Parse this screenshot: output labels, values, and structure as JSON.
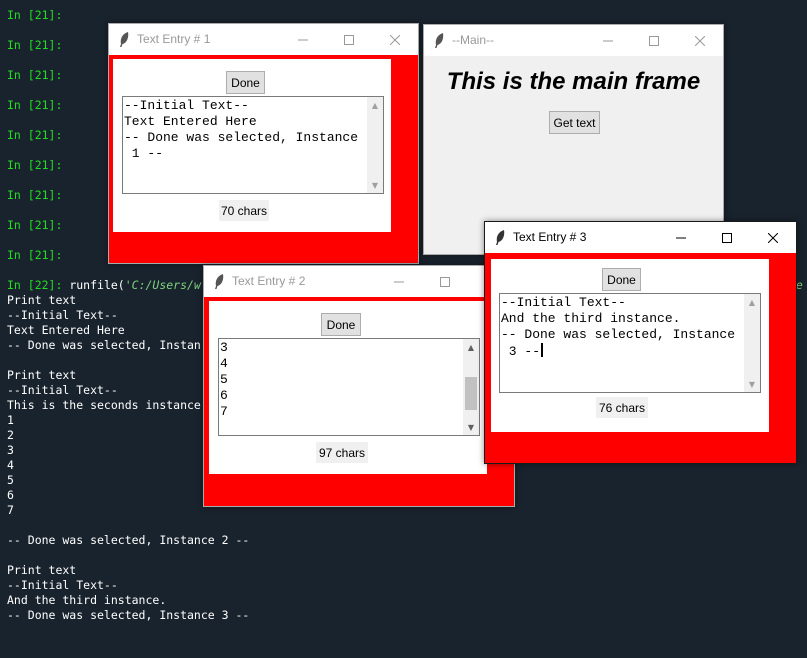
{
  "console": {
    "prompt_lines": [
      "In [21]:",
      "In [21]:",
      "In [21]:",
      "In [21]:",
      "In [21]:",
      "In [21]:",
      "In [21]:",
      "In [21]:",
      "In [21]:"
    ],
    "run_prompt": "In [22]:",
    "run_call": "runfile(",
    "run_path": "'C:/Users/w",
    "run_path_tail": "he",
    "output": [
      "Print text",
      "--Initial Text--",
      "Text Entered Here",
      "-- Done was selected, Instan",
      "",
      "Print text",
      "--Initial Text--",
      "This is the seconds instance",
      "1",
      "2",
      "3",
      "4",
      "5",
      "6",
      "7",
      "",
      "-- Done was selected, Instance 2 --",
      "",
      "Print text",
      "--Initial Text--",
      "And the third instance.",
      "-- Done was selected, Instance 3 --"
    ]
  },
  "win1": {
    "title": "Text Entry # 1",
    "done_label": "Done",
    "text": "--Initial Text--\nText Entered Here\n-- Done was selected, Instance\n 1 --",
    "count": "70 chars"
  },
  "main": {
    "title": "--Main--",
    "heading": "This is the main frame",
    "get_text_label": "Get text"
  },
  "win2": {
    "title": "Text Entry # 2",
    "done_label": "Done",
    "text": "3\n4\n5\n6\n7",
    "count": "97 chars"
  },
  "win3": {
    "title": "Text Entry # 3",
    "done_label": "Done",
    "text": "--Initial Text--\nAnd the third instance.\n-- Done was selected, Instance\n 3 --",
    "count": "76 chars"
  },
  "colors": {
    "console_bg": "#19232d",
    "prompt": "#22dd22",
    "frame_red": "#ff0000"
  },
  "icons": [
    "feather-icon",
    "minimize-icon",
    "maximize-icon",
    "close-icon",
    "scroll-up-icon",
    "scroll-down-icon"
  ]
}
